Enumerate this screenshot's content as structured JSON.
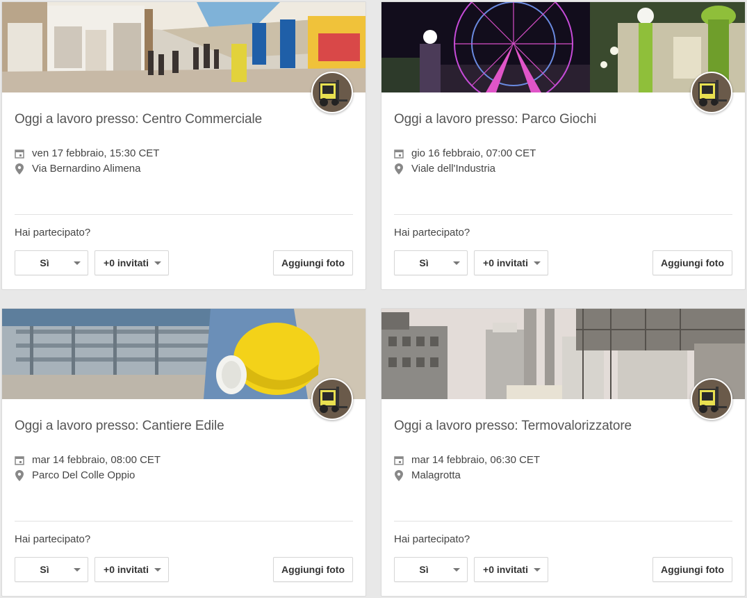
{
  "cards": [
    {
      "title": "Oggi a lavoro presso: Centro Commerciale",
      "date": "ven 17 febbraio, 15:30 CET",
      "place": "Via Bernardino Alimena",
      "question": "Hai partecipato?",
      "rsvp": "Sì",
      "guests": "+0 invitati",
      "photo": "Aggiungi foto"
    },
    {
      "title": "Oggi a lavoro presso: Parco Giochi",
      "date": "gio 16 febbraio, 07:00 CET",
      "place": "Viale dell'Industria",
      "question": "Hai partecipato?",
      "rsvp": "Sì",
      "guests": "+0 invitati",
      "photo": "Aggiungi foto"
    },
    {
      "title": "Oggi a lavoro presso: Cantiere Edile",
      "date": "mar 14 febbraio, 08:00 CET",
      "place": "Parco Del Colle Oppio",
      "question": "Hai partecipato?",
      "rsvp": "Sì",
      "guests": "+0 invitati",
      "photo": "Aggiungi foto"
    },
    {
      "title": "Oggi a lavoro presso: Termovalorizzatore",
      "date": "mar 14 febbraio, 06:30 CET",
      "place": "Malagrotta",
      "question": "Hai partecipato?",
      "rsvp": "Sì",
      "guests": "+0 invitati",
      "photo": "Aggiungi foto"
    }
  ],
  "icons": {
    "date": "calendar-icon",
    "place": "location-pin-icon",
    "dropdown": "caret-down-icon",
    "avatar": "forklift-avatar"
  },
  "colors": {
    "background": "#e8e8e8",
    "card": "#ffffff",
    "title_text": "#555555",
    "border": "#d9d9d9"
  }
}
